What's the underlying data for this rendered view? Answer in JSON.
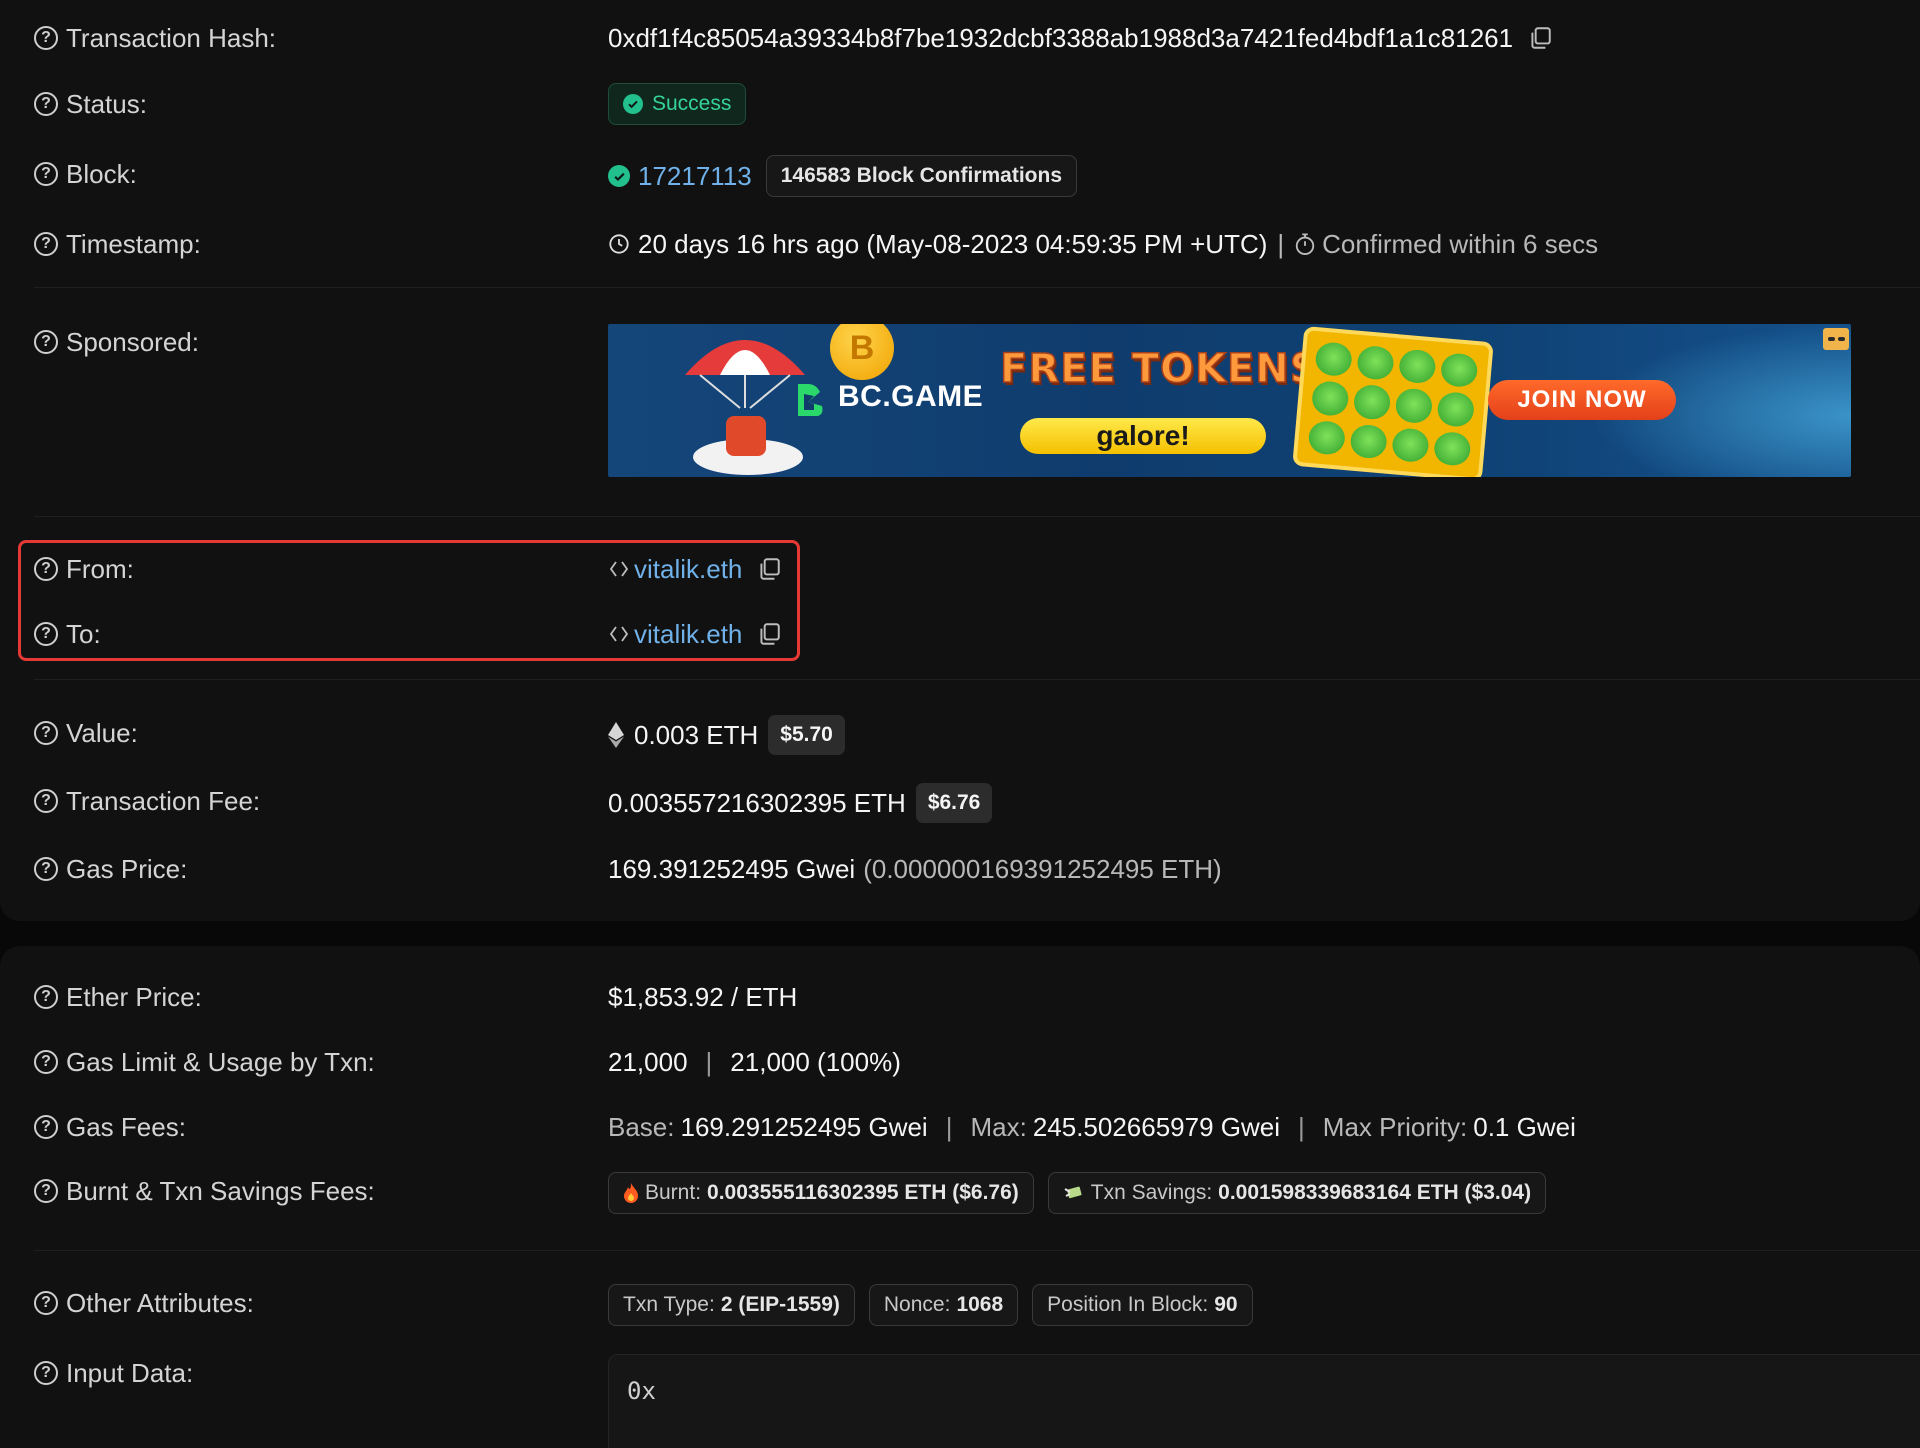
{
  "txn": {
    "hash_label": "Transaction Hash:",
    "hash": "0xdf1f4c85054a39334b8f7be1932dcbf3388ab1988d3a7421fed4bdf1a1c81261",
    "status_label": "Status:",
    "status": "Success",
    "block_label": "Block:",
    "block_number": "17217113",
    "confirmations": "146583 Block Confirmations",
    "timestamp_label": "Timestamp:",
    "timestamp": "20 days 16 hrs ago (May-08-2023 04:59:35 PM +UTC)",
    "timestamp_sep": "|",
    "confirmed": "Confirmed within 6 secs",
    "sponsored_label": "Sponsored:",
    "from_label": "From:",
    "from": "vitalik.eth",
    "to_label": "To:",
    "to": "vitalik.eth",
    "value_label": "Value:",
    "value": "0.003 ETH",
    "value_usd": "$5.70",
    "fee_label": "Transaction Fee:",
    "fee": "0.003557216302395 ETH",
    "fee_usd": "$6.76",
    "gas_price_label": "Gas Price:",
    "gas_price": "169.391252495 Gwei",
    "gas_price_eth": "(0.000000169391252495 ETH)"
  },
  "banner": {
    "brand": "BC.GAME",
    "headline": "FREE TOKENS",
    "subline": "galore!",
    "cta": "JOIN NOW",
    "coin_symbol": "B"
  },
  "more": {
    "ether_price_label": "Ether Price:",
    "ether_price": "$1,853.92 / ETH",
    "gas_limit_label": "Gas Limit & Usage by Txn:",
    "gas_limit": "21,000",
    "gas_sep": "|",
    "gas_usage": "21,000 (100%)",
    "gas_fees_label": "Gas Fees:",
    "base_k": "Base:",
    "base_v": "169.291252495 Gwei",
    "max_k": "Max:",
    "max_v": "245.502665979 Gwei",
    "priority_k": "Max Priority:",
    "priority_v": "0.1 Gwei",
    "burnt_label": "Burnt & Txn Savings Fees:",
    "burnt_k": "Burnt:",
    "burnt_v": "0.003555116302395 ETH ($6.76)",
    "savings_k": "Txn Savings:",
    "savings_v": "0.001598339683164 ETH ($3.04)",
    "other_label": "Other Attributes:",
    "type_k": "Txn Type:",
    "type_v": "2 (EIP-1559)",
    "nonce_k": "Nonce:",
    "nonce_v": "1068",
    "position_k": "Position In Block:",
    "position_v": "90",
    "input_label": "Input Data:",
    "input_value": "0x"
  },
  "colors": {
    "accent_link": "#6fb1e8",
    "success": "#34d399",
    "highlight": "#e53935"
  }
}
